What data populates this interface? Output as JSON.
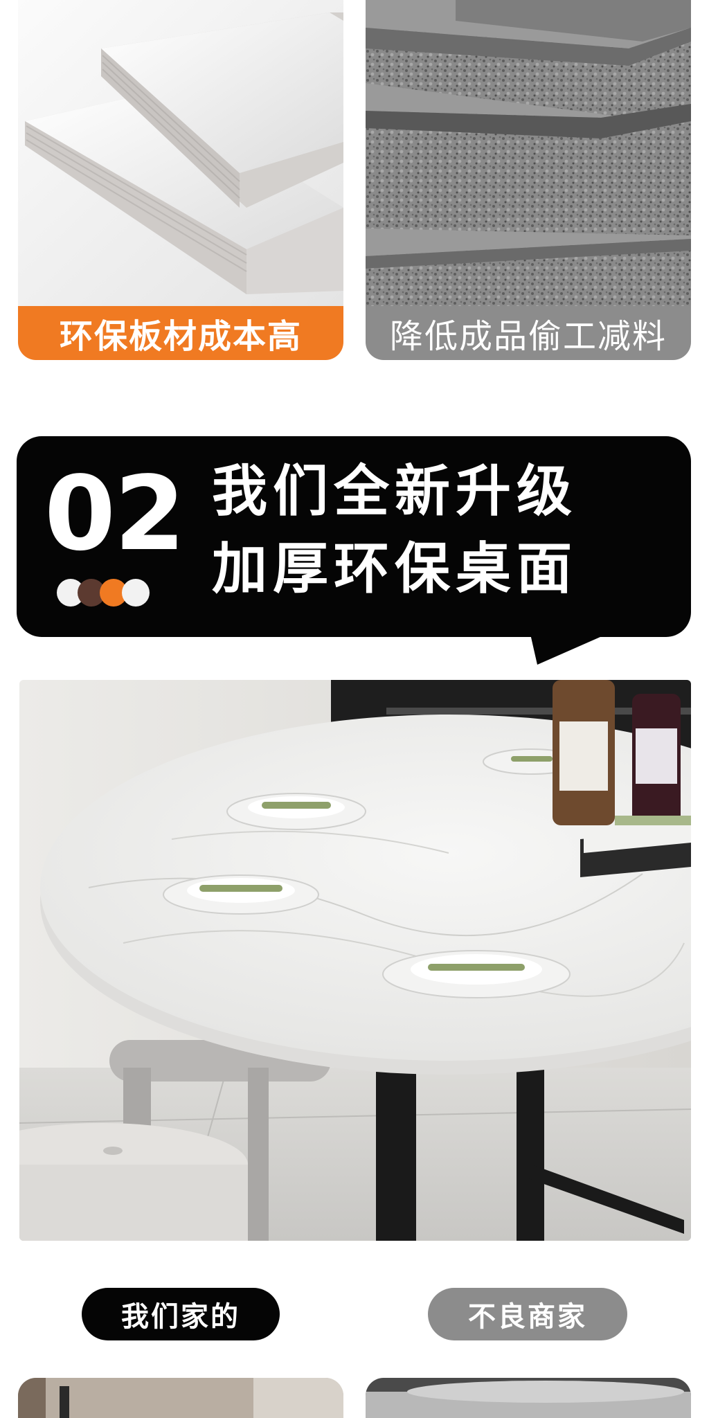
{
  "colors": {
    "page_bg": "#ffffff",
    "accent_orange": "#f07a22",
    "muted_gray": "#8c8c8c",
    "banner_black": "#050505"
  },
  "comparison_top": {
    "left_caption": "环保板材成本高",
    "right_caption": "降低成品偷工减料"
  },
  "banner": {
    "number": "02",
    "line1": "我们全新升级",
    "line2": "加厚环保桌面",
    "dot_colors": [
      "#f2f2f2",
      "#5c3a30",
      "#f07a22",
      "#f2f2f2"
    ]
  },
  "comparison_bottom": {
    "left_label": "我们家的",
    "right_label": "不良商家"
  }
}
